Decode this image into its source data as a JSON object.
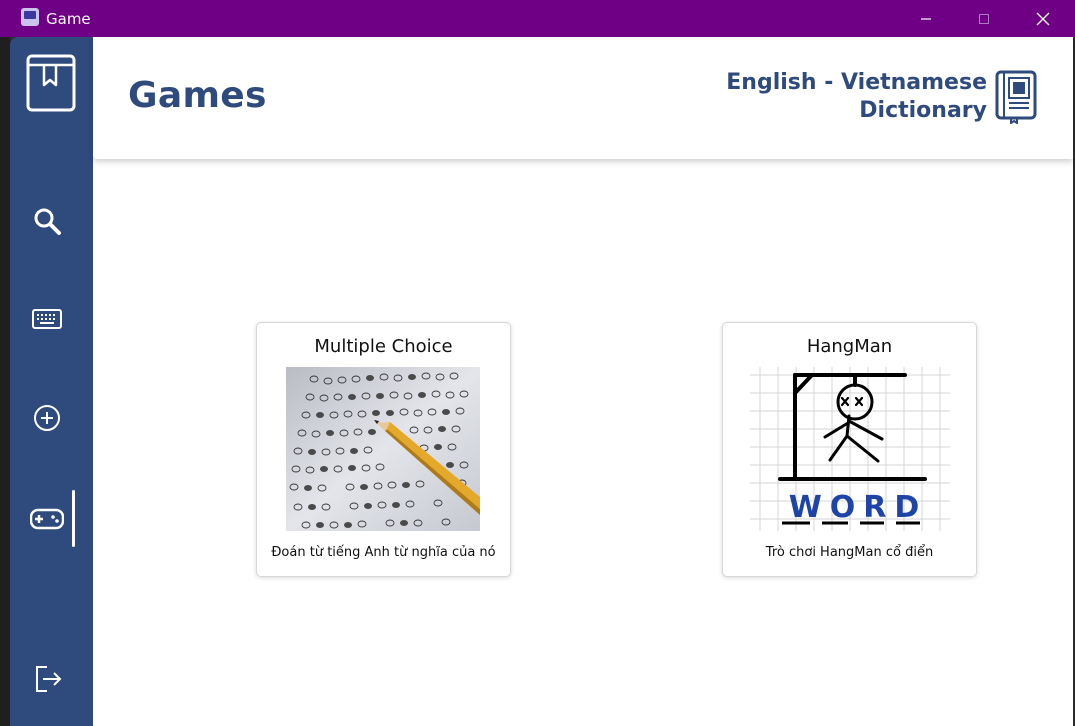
{
  "window": {
    "title": "Game",
    "controls": [
      "minimize",
      "maximize",
      "close"
    ]
  },
  "colors": {
    "titlebar": "#6f0085",
    "sidebar": "#2f4a7c",
    "accent_text": "#2f4a7c",
    "content_bg": "#ffffff"
  },
  "sidebar": {
    "logo_icon": "bookmark-book-icon",
    "items": [
      {
        "icon": "search-icon",
        "active": false
      },
      {
        "icon": "keyboard-icon",
        "active": false
      },
      {
        "icon": "add-circle-icon",
        "active": false
      },
      {
        "icon": "gamepad-icon",
        "active": true
      }
    ],
    "bottom_item": {
      "icon": "logout-icon"
    }
  },
  "header": {
    "title": "Games",
    "brand_line1": "English - Vietnamese",
    "brand_line2": "Dictionary",
    "brand_icon": "dictionary-book-icon"
  },
  "games": [
    {
      "title": "Multiple Choice",
      "description": "Đoán từ tiếng Anh từ nghĩa của nó",
      "image": "answer-sheet-with-pencil"
    },
    {
      "title": "HangMan",
      "description": "Trò chơi HangMan cổ điển",
      "image": "hangman-drawing",
      "image_word": "WORD"
    }
  ]
}
